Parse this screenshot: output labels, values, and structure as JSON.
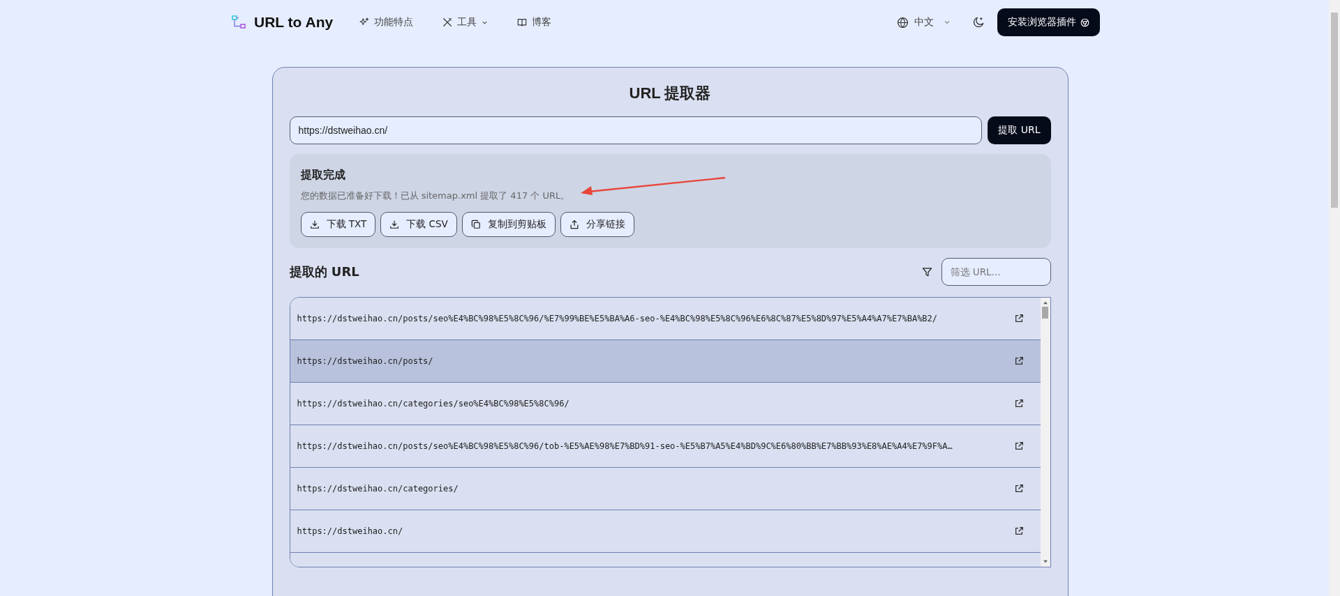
{
  "nav": {
    "logo": "URL to Any",
    "links": [
      {
        "label": "功能特点",
        "kind": "sparkle",
        "dropdown": false
      },
      {
        "label": "工具",
        "kind": "tools",
        "dropdown": true
      },
      {
        "label": "博客",
        "kind": "book",
        "dropdown": false
      }
    ],
    "language": "中文",
    "install_button": "安装浏览器插件"
  },
  "extractor": {
    "title": "URL 提取器",
    "url_value": "https://dstweihao.cn/",
    "extract_button": "提取 URL",
    "result": {
      "title": "提取完成",
      "message": "您的数据已准备好下载！已从 sitemap.xml 提取了 417 个 URL。",
      "actions": [
        {
          "label": "下载 TXT",
          "kind": "download"
        },
        {
          "label": "下载 CSV",
          "kind": "download"
        },
        {
          "label": "复制到剪贴板",
          "kind": "copy"
        },
        {
          "label": "分享链接",
          "kind": "share"
        }
      ]
    },
    "list_title": "提取的 URL",
    "filter_placeholder": "筛选 URL...",
    "urls": [
      {
        "url": "https://dstweihao.cn/posts/seo%E4%BC%98%E5%8C%96/%E7%99%BE%E5%BA%A6-seo-%E4%BC%98%E5%8C%96%E6%8C%87%E5%8D%97%E5%A4%A7%E7%BA%B2/",
        "selected": false
      },
      {
        "url": "https://dstweihao.cn/posts/",
        "selected": true
      },
      {
        "url": "https://dstweihao.cn/categories/seo%E4%BC%98%E5%8C%96/",
        "selected": false
      },
      {
        "url": "https://dstweihao.cn/posts/seo%E4%BC%98%E5%8C%96/tob-%E5%AE%98%E7%BD%91-seo-%E5%B7%A5%E4%BD%9C%E6%80%BB%E7%BB%93%E8%AE%A4%E7%9F%A…",
        "selected": false
      },
      {
        "url": "https://dstweihao.cn/categories/",
        "selected": false
      },
      {
        "url": "https://dstweihao.cn/",
        "selected": false
      }
    ]
  }
}
